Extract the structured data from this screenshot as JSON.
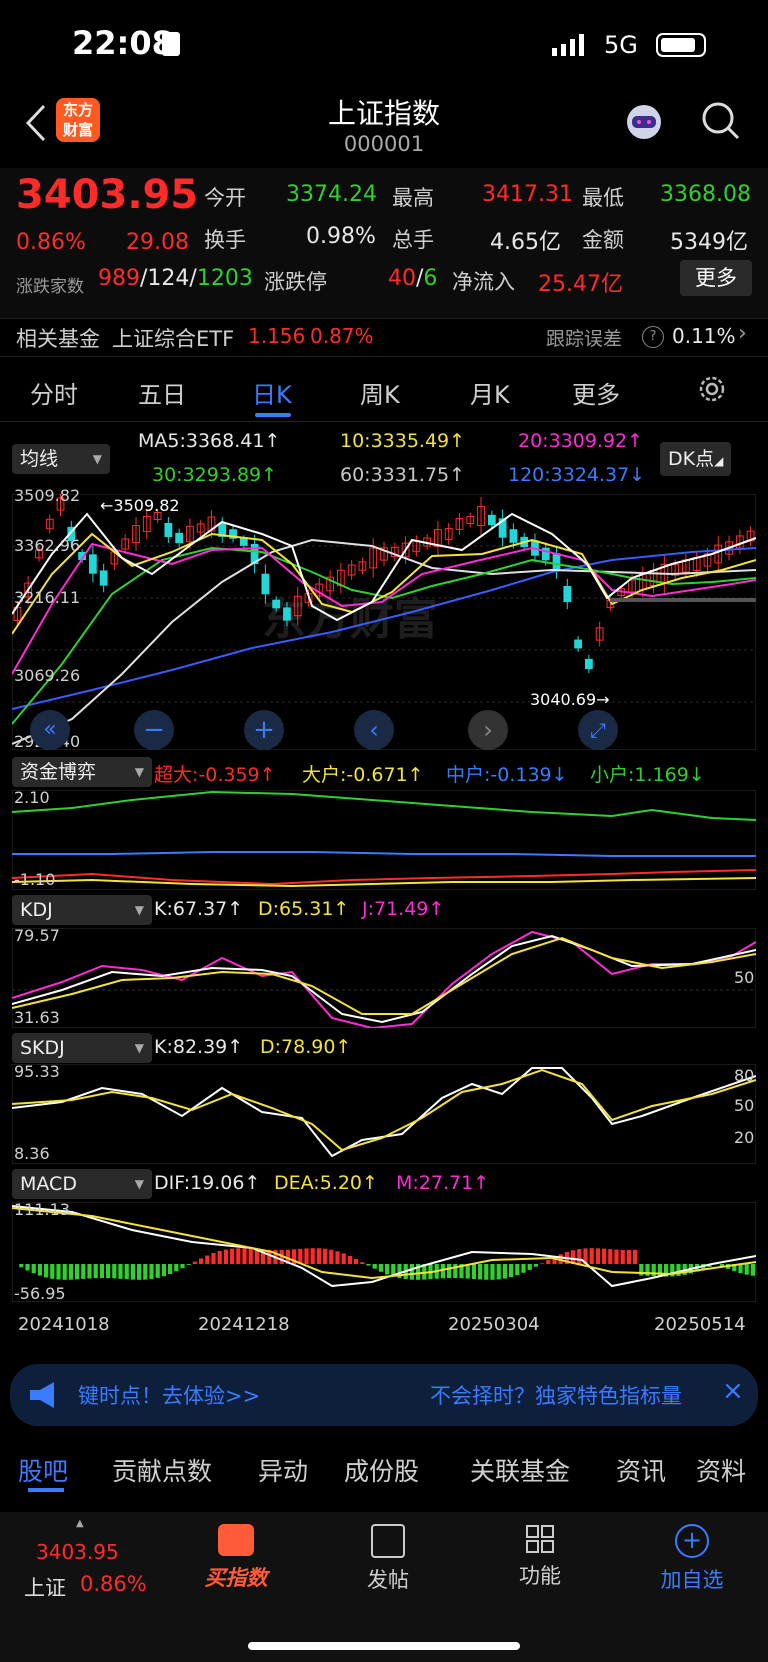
{
  "status": {
    "time": "22:08",
    "network": "5G"
  },
  "header": {
    "title": "上证指数",
    "code": "000001",
    "logo_text": "东方财富"
  },
  "quote": {
    "price": "3403.95",
    "change_pct": "0.86%",
    "change": "29.08",
    "open_label": "今开",
    "open": "3374.24",
    "high_label": "最高",
    "high": "3417.31",
    "low_label": "最低",
    "low": "3368.08",
    "turnover_label": "换手",
    "turnover": "0.98%",
    "volume_label": "总手",
    "volume": "4.65亿",
    "amount_label": "金额",
    "amount": "5349亿",
    "breadth_label": "涨跌家数",
    "up": "989",
    "flat": "124",
    "down": "1203",
    "limit_label": "涨跌停",
    "limit_up": "40",
    "limit_down": "6",
    "inflow_label": "净流入",
    "inflow": "25.47亿",
    "more": "更多"
  },
  "fund": {
    "label": "相关基金",
    "name": "上证综合ETF",
    "price": "1.156",
    "pct": "0.87%",
    "track_label": "跟踪误差",
    "track": "0.11%"
  },
  "tabs": [
    "分时",
    "五日",
    "日K",
    "周K",
    "月K",
    "更多"
  ],
  "main_chart": {
    "ma_select": "均线",
    "dk": "DK点",
    "ma5": "MA5:3368.41↑",
    "ma10": "10:3335.49↑",
    "ma20": "20:3309.92↑",
    "ma30": "30:3293.89↑",
    "ma60": "60:3331.75↑",
    "ma120": "120:3324.37↓",
    "y_labels": [
      "3509.82",
      "3362.96",
      "3216.11",
      "3069.26",
      "2922.40"
    ],
    "high_mark": "3509.82",
    "low_mark": "3040.69"
  },
  "fund_flow": {
    "select": "资金博弈",
    "super": "超大:-0.359↑",
    "large": "大户:-0.671↑",
    "mid": "中户:-0.139↓",
    "small": "小户:1.169↓",
    "y_top": "2.10",
    "y_bot": "-1.10"
  },
  "kdj": {
    "select": "KDJ",
    "k": "K:67.37↑",
    "d": "D:65.31↑",
    "j": "J:71.49↑",
    "y_top": "79.57",
    "y_bot": "31.63",
    "y_mid": "50"
  },
  "skdj": {
    "select": "SKDJ",
    "k": "K:82.39↑",
    "d": "D:78.90↑",
    "y_top": "95.33",
    "y_bot": "8.36",
    "r80": "80",
    "r50": "50",
    "r20": "20"
  },
  "macd": {
    "select": "MACD",
    "dif": "DIF:19.06↑",
    "dea": "DEA:5.20↑",
    "m": "M:27.71↑",
    "y_top": "111.13",
    "y_bot": "-56.95"
  },
  "dates": [
    "20241018",
    "20241218",
    "20250304",
    "20250514"
  ],
  "banner": {
    "left": "键时点！去体验>>",
    "right": "不会择时？独家特色指标量"
  },
  "subtabs": [
    "股吧",
    "贡献点数",
    "异动",
    "成份股",
    "关联基金",
    "资讯",
    "资料"
  ],
  "bottom": {
    "mini_price": "3403.95",
    "mini_name": "上证",
    "mini_pct": "0.86%",
    "buy": "买指数",
    "post": "发帖",
    "func": "功能",
    "add": "加自选"
  },
  "colors": {
    "up": "#ff2b2b",
    "down": "#2fd12f",
    "accent": "#3a7bff"
  }
}
